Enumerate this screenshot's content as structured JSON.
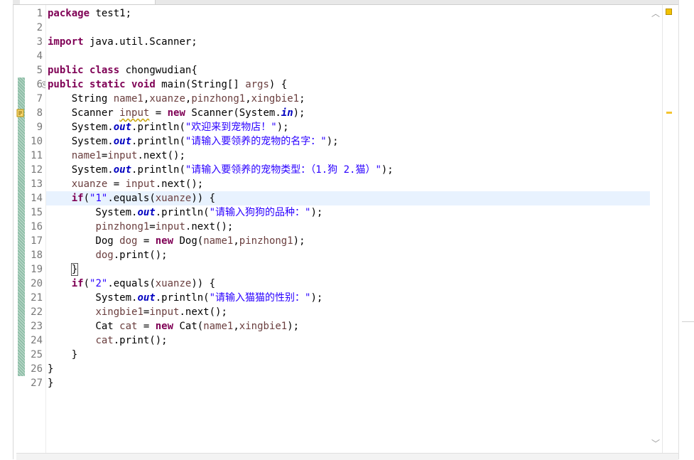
{
  "editor": {
    "current_line": 14,
    "lines": [
      {
        "num": "1",
        "tokens": [
          [
            "kw",
            "package"
          ],
          [
            "plain",
            " test1;"
          ]
        ]
      },
      {
        "num": "2",
        "tokens": []
      },
      {
        "num": "3",
        "tokens": [
          [
            "kw",
            "import"
          ],
          [
            "plain",
            " java.util.Scanner;"
          ]
        ]
      },
      {
        "num": "4",
        "tokens": []
      },
      {
        "num": "5",
        "tokens": [
          [
            "kw",
            "public"
          ],
          [
            "plain",
            " "
          ],
          [
            "kw",
            "class"
          ],
          [
            "plain",
            " chongwudian{"
          ]
        ]
      },
      {
        "num": "6",
        "tokens": [
          [
            "kw",
            "public"
          ],
          [
            "plain",
            " "
          ],
          [
            "kw",
            "static"
          ],
          [
            "plain",
            " "
          ],
          [
            "kw",
            "void"
          ],
          [
            "plain",
            " main(String[] "
          ],
          [
            "var",
            "args"
          ],
          [
            "plain",
            ") {"
          ]
        ]
      },
      {
        "num": "7",
        "tokens": [
          [
            "plain",
            "    String "
          ],
          [
            "var",
            "name1"
          ],
          [
            "plain",
            ","
          ],
          [
            "var",
            "xuanze"
          ],
          [
            "plain",
            ","
          ],
          [
            "var",
            "pinzhong1"
          ],
          [
            "plain",
            ","
          ],
          [
            "var",
            "xingbie1"
          ],
          [
            "plain",
            ";"
          ]
        ]
      },
      {
        "num": "8",
        "tokens": [
          [
            "plain",
            "    Scanner "
          ],
          [
            "warnvar",
            "input"
          ],
          [
            "plain",
            " = "
          ],
          [
            "kw",
            "new"
          ],
          [
            "plain",
            " Scanner(System."
          ],
          [
            "fld",
            "in"
          ],
          [
            "plain",
            ");"
          ]
        ]
      },
      {
        "num": "9",
        "tokens": [
          [
            "plain",
            "    System."
          ],
          [
            "fld",
            "out"
          ],
          [
            "plain",
            ".println("
          ],
          [
            "str",
            "\"欢迎来到宠物店！\""
          ],
          [
            "plain",
            ");"
          ]
        ]
      },
      {
        "num": "10",
        "tokens": [
          [
            "plain",
            "    System."
          ],
          [
            "fld",
            "out"
          ],
          [
            "plain",
            ".println("
          ],
          [
            "str",
            "\"请输入要领养的宠物的名字：\""
          ],
          [
            "plain",
            ");"
          ]
        ]
      },
      {
        "num": "11",
        "tokens": [
          [
            "plain",
            "    "
          ],
          [
            "var",
            "name1"
          ],
          [
            "plain",
            "="
          ],
          [
            "var",
            "input"
          ],
          [
            "plain",
            ".next();"
          ]
        ]
      },
      {
        "num": "12",
        "tokens": [
          [
            "plain",
            "    System."
          ],
          [
            "fld",
            "out"
          ],
          [
            "plain",
            ".println("
          ],
          [
            "str",
            "\"请输入要领养的宠物类型：（1.狗 2.猫）\""
          ],
          [
            "plain",
            ");"
          ]
        ]
      },
      {
        "num": "13",
        "tokens": [
          [
            "plain",
            "    "
          ],
          [
            "var",
            "xuanze"
          ],
          [
            "plain",
            " = "
          ],
          [
            "var",
            "input"
          ],
          [
            "plain",
            ".next();"
          ]
        ]
      },
      {
        "num": "14",
        "tokens": [
          [
            "plain",
            "    "
          ],
          [
            "kw",
            "if"
          ],
          [
            "plain",
            "("
          ],
          [
            "str",
            "\"1\""
          ],
          [
            "plain",
            ".equals("
          ],
          [
            "var",
            "xuanze"
          ],
          [
            "plain",
            ")) {"
          ]
        ]
      },
      {
        "num": "15",
        "tokens": [
          [
            "plain",
            "        System."
          ],
          [
            "fld",
            "out"
          ],
          [
            "plain",
            ".println("
          ],
          [
            "str",
            "\"请输入狗狗的品种：\""
          ],
          [
            "plain",
            ");"
          ]
        ]
      },
      {
        "num": "16",
        "tokens": [
          [
            "plain",
            "        "
          ],
          [
            "var",
            "pinzhong1"
          ],
          [
            "plain",
            "="
          ],
          [
            "var",
            "input"
          ],
          [
            "plain",
            ".next();"
          ]
        ]
      },
      {
        "num": "17",
        "tokens": [
          [
            "plain",
            "        Dog "
          ],
          [
            "var",
            "dog"
          ],
          [
            "plain",
            " = "
          ],
          [
            "kw",
            "new"
          ],
          [
            "plain",
            " Dog("
          ],
          [
            "var",
            "name1"
          ],
          [
            "plain",
            ","
          ],
          [
            "var",
            "pinzhong1"
          ],
          [
            "plain",
            ");"
          ]
        ]
      },
      {
        "num": "18",
        "tokens": [
          [
            "plain",
            "        "
          ],
          [
            "var",
            "dog"
          ],
          [
            "plain",
            ".print();"
          ]
        ]
      },
      {
        "num": "19",
        "tokens": [
          [
            "plain",
            "    "
          ],
          [
            "bracket",
            "}"
          ]
        ]
      },
      {
        "num": "20",
        "tokens": [
          [
            "plain",
            "    "
          ],
          [
            "kw",
            "if"
          ],
          [
            "plain",
            "("
          ],
          [
            "str",
            "\"2\""
          ],
          [
            "plain",
            ".equals("
          ],
          [
            "var",
            "xuanze"
          ],
          [
            "plain",
            ")) {"
          ]
        ]
      },
      {
        "num": "21",
        "tokens": [
          [
            "plain",
            "        System."
          ],
          [
            "fld",
            "out"
          ],
          [
            "plain",
            ".println("
          ],
          [
            "str",
            "\"请输入猫猫的性别：\""
          ],
          [
            "plain",
            ");"
          ]
        ]
      },
      {
        "num": "22",
        "tokens": [
          [
            "plain",
            "        "
          ],
          [
            "var",
            "xingbie1"
          ],
          [
            "plain",
            "="
          ],
          [
            "var",
            "input"
          ],
          [
            "plain",
            ".next();"
          ]
        ]
      },
      {
        "num": "23",
        "tokens": [
          [
            "plain",
            "        Cat "
          ],
          [
            "var",
            "cat"
          ],
          [
            "plain",
            " = "
          ],
          [
            "kw",
            "new"
          ],
          [
            "plain",
            " Cat("
          ],
          [
            "var",
            "name1"
          ],
          [
            "plain",
            ","
          ],
          [
            "var",
            "xingbie1"
          ],
          [
            "plain",
            ");"
          ]
        ]
      },
      {
        "num": "24",
        "tokens": [
          [
            "plain",
            "        "
          ],
          [
            "var",
            "cat"
          ],
          [
            "plain",
            ".print();"
          ]
        ]
      },
      {
        "num": "25",
        "tokens": [
          [
            "plain",
            "    }"
          ]
        ]
      },
      {
        "num": "26",
        "tokens": [
          [
            "plain",
            "}"
          ]
        ]
      },
      {
        "num": "27",
        "tokens": [
          [
            "plain",
            "}"
          ]
        ]
      }
    ],
    "fold_marker_line": 6,
    "fold_marker_glyph": "⊖",
    "warning_line": 8,
    "changed_lines_from": 6,
    "changed_lines_to": 26
  },
  "colors": {
    "keyword": "#7f0055",
    "string": "#2a00ff",
    "static_field": "#0000c0",
    "local_variable": "#6a3e3e",
    "current_line_highlight": "#e8f2fe",
    "change_ruler": "#8fbfa8"
  },
  "icons": {
    "scroll_up": "chevron-up-icon",
    "scroll_down": "chevron-down-icon",
    "warning": "warning-icon",
    "fold": "collapse-icon"
  }
}
